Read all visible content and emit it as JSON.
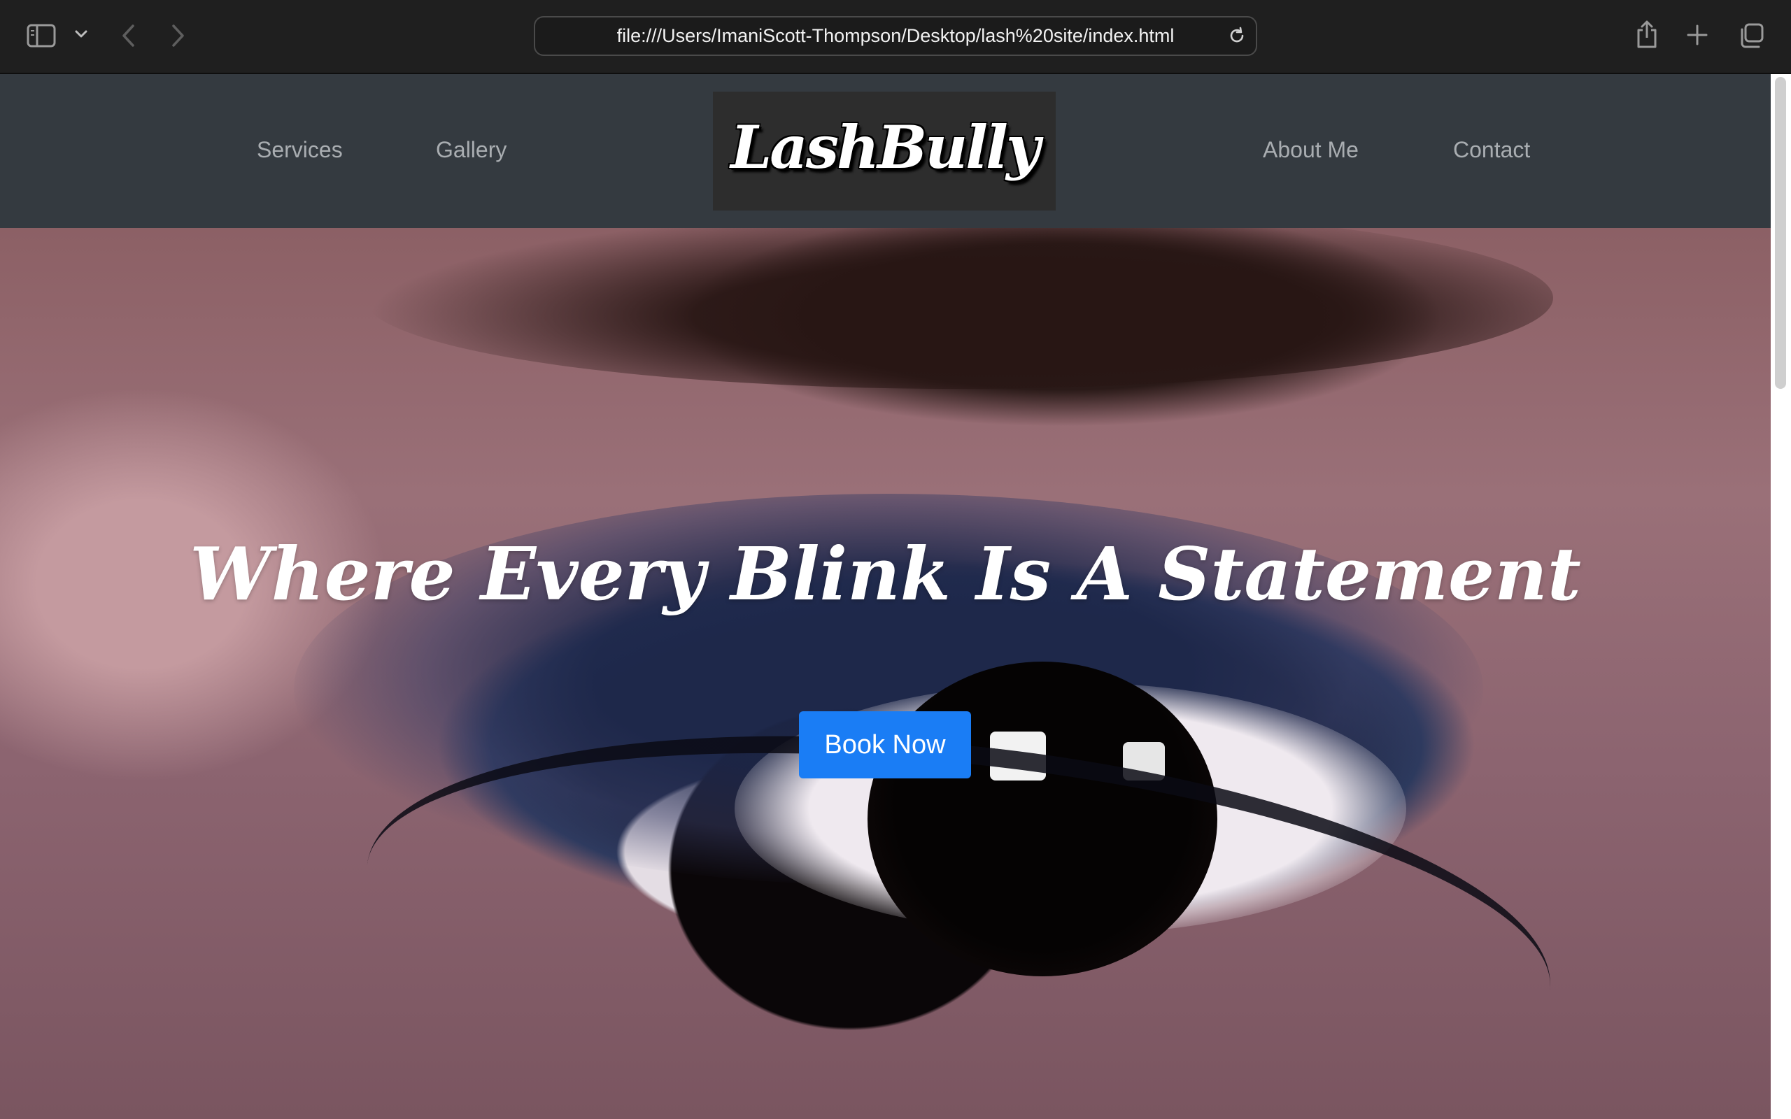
{
  "browser": {
    "url": "file:///Users/ImaniScott-Thompson/Desktop/lash%20site/index.html",
    "icons": {
      "sidebar": "sidebar-icon",
      "sidebar_menu": "chevron-down-icon",
      "back": "back-arrow-icon",
      "forward": "forward-arrow-icon",
      "reload": "reload-icon",
      "share": "share-icon",
      "new_tab": "plus-icon",
      "tabs": "tab-overview-icon"
    }
  },
  "site": {
    "nav": {
      "services": "Services",
      "gallery": "Gallery",
      "about": "About Me",
      "contact": "Contact"
    },
    "logo": "LashBully",
    "hero": {
      "headline": "Where Every Blink Is A Statement",
      "cta": "Book Now"
    },
    "colors": {
      "navbar_bg": "#343a40",
      "nav_link": "#a9adb1",
      "cta_bg": "#1a7df5",
      "cta_text": "#ffffff"
    }
  }
}
